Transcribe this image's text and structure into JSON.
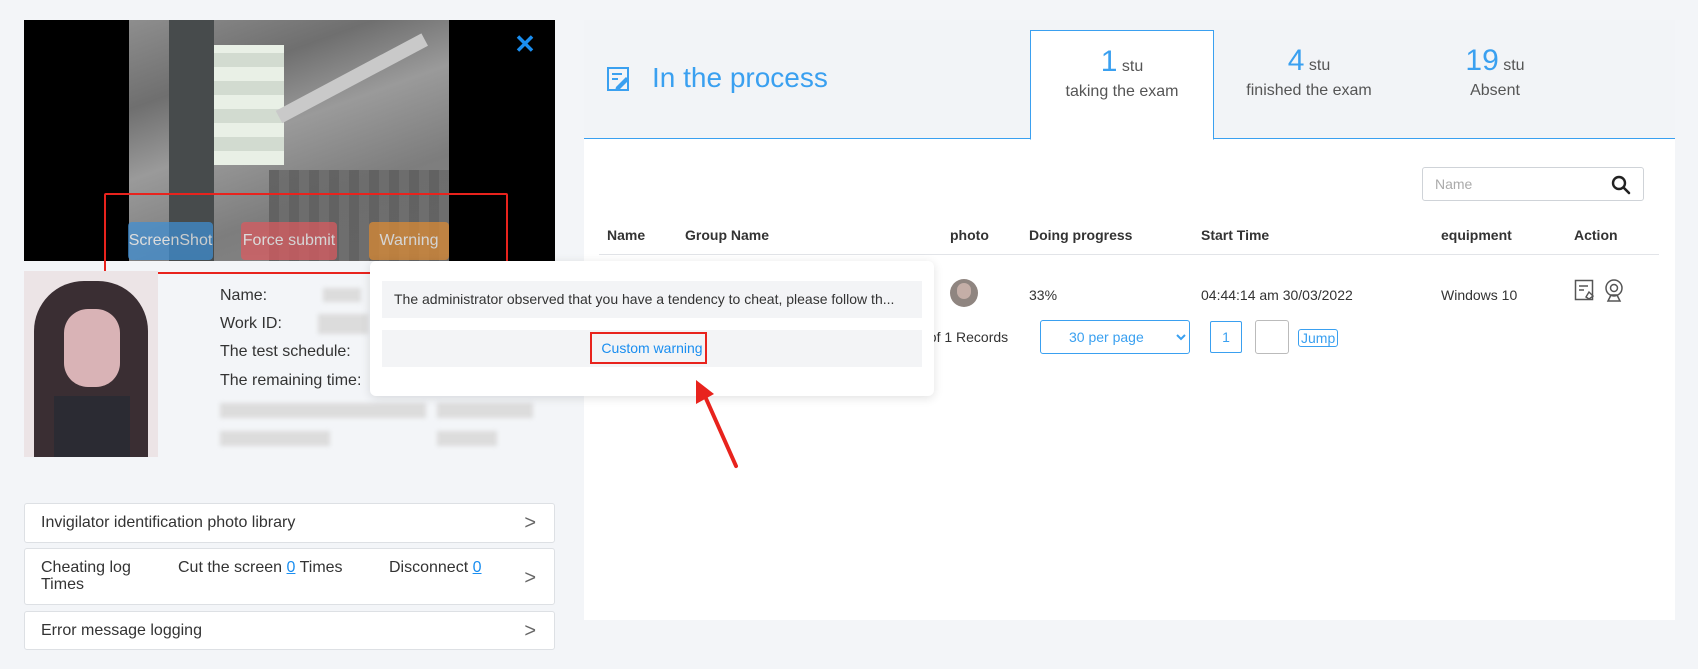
{
  "video": {
    "buttons": {
      "screenshot": "ScreenShot",
      "force_submit": "Force submit",
      "warning": "Warning"
    },
    "close_icon": "close-icon",
    "close_color": "#1a8ef0"
  },
  "student": {
    "labels": {
      "name": "Name:",
      "work_id": "Work ID:",
      "schedule": "The test schedule:",
      "remaining": "The remaining time:"
    }
  },
  "warning_menu": {
    "preset": "The administrator observed that you have a tendency to cheat, please follow th...",
    "custom": "Custom warning"
  },
  "side_items": {
    "photo_library": "Invigilator identification photo library",
    "cheating_log": "Cheating log Times",
    "cut_screen_prefix": "Cut the screen",
    "cut_screen_count": "0",
    "cut_screen_suffix": "Times",
    "disconnect_label": "Disconnect",
    "disconnect_count": "0",
    "error_logging": "Error message logging"
  },
  "header": {
    "title": "In the process",
    "stats": [
      {
        "count": "1",
        "unit": "stu",
        "label": "taking the exam"
      },
      {
        "count": "4",
        "unit": "stu",
        "label": "finished the exam"
      },
      {
        "count": "19",
        "unit": "stu",
        "label": "Absent"
      }
    ]
  },
  "search": {
    "placeholder": "Name"
  },
  "table": {
    "headers": [
      "Name",
      "Group Name",
      "photo",
      "Doing progress",
      "Start Time",
      "equipment",
      "Action"
    ],
    "rows": [
      {
        "progress": "33%",
        "start_time": "04:44:14 am 30/03/2022",
        "equipment": "Windows 10"
      }
    ]
  },
  "pager": {
    "total_text": "al of 1 Records",
    "per_page": "30 per page",
    "per_page_options": [
      "30 per page"
    ],
    "current_page": "1",
    "jump": "Jump"
  },
  "colors": {
    "accent": "#3aa0f0",
    "highlight_box": "#e8231d",
    "screenshot_btn": "#3f8fd4",
    "force_btn": "#dc5a5f",
    "warning_btn": "#df8c33"
  }
}
